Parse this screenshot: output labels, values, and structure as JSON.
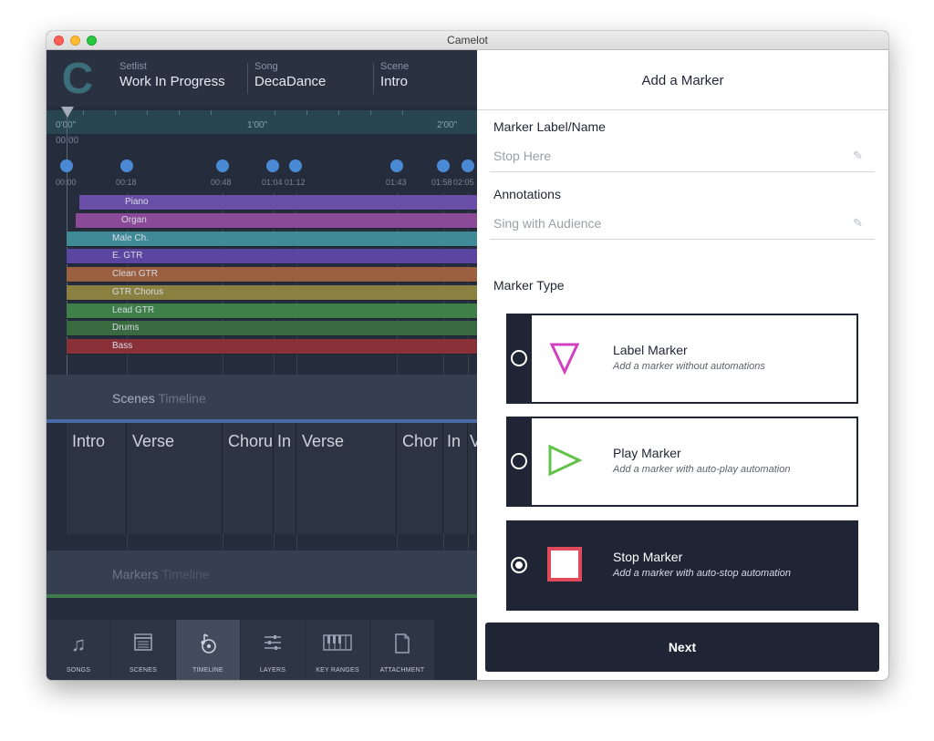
{
  "window": {
    "title": "Camelot"
  },
  "header": {
    "setlist_label": "Setlist",
    "setlist_value": "Work In Progress",
    "song_label": "Song",
    "song_value": "DecaDance",
    "scene_label": "Scene",
    "scene_value": "Intro"
  },
  "timeline": {
    "ruler_labels": [
      "0'00\"",
      "1'00\"",
      "2'00\""
    ],
    "playhead_time": "00:00",
    "marker_times": [
      "00:00",
      "00:18",
      "00:48",
      "01:04",
      "01:12",
      "01:43",
      "01:58",
      "02:05"
    ],
    "tracks": [
      {
        "name": "Piano",
        "color": "#6a4fa8"
      },
      {
        "name": "Organ",
        "color": "#8a4a98"
      },
      {
        "name": "Male Ch.",
        "color": "#3f8a96"
      },
      {
        "name": "E. GTR",
        "color": "#5a45a0"
      },
      {
        "name": "Clean GTR",
        "color": "#9a6040"
      },
      {
        "name": "GTR Chorus",
        "color": "#8a8040"
      },
      {
        "name": "Lead GTR",
        "color": "#3f8048"
      },
      {
        "name": "Drums",
        "color": "#3a6a40"
      },
      {
        "name": "Bass",
        "color": "#8a3038"
      }
    ],
    "scenes_band": {
      "title": "Scenes",
      "subtitle": "Timeline"
    },
    "scenes": [
      "Intro",
      "Verse",
      "Choru",
      "In",
      "Verse",
      "Chor",
      "In",
      "V"
    ],
    "markers_band": {
      "title": "Markers",
      "subtitle": "Timeline"
    }
  },
  "tabs": [
    {
      "label": "SONGS",
      "icon": "music-note-icon"
    },
    {
      "label": "SCENES",
      "icon": "clapperboard-icon"
    },
    {
      "label": "TIMELINE",
      "icon": "timeline-icon",
      "active": true
    },
    {
      "label": "LAYERS",
      "icon": "sliders-icon"
    },
    {
      "label": "KEY RANGES",
      "icon": "piano-keys-icon"
    },
    {
      "label": "ATTACHMENT",
      "icon": "document-icon"
    }
  ],
  "panel": {
    "title": "Add a Marker",
    "label_field": {
      "label": "Marker Label/Name",
      "value": "Stop Here"
    },
    "annotation_field": {
      "label": "Annotations",
      "value": "Sing with Audience"
    },
    "type_label": "Marker Type",
    "marker_types": [
      {
        "title": "Label Marker",
        "desc": "Add a marker without automations",
        "icon": "triangle-down-icon",
        "color": "#d040c0",
        "selected": false
      },
      {
        "title": "Play Marker",
        "desc": "Add a marker with auto-play automation",
        "icon": "play-triangle-icon",
        "color": "#62c24a",
        "selected": false
      },
      {
        "title": "Stop Marker",
        "desc": "Add a marker with auto-stop automation",
        "icon": "stop-square-icon",
        "color": "#e04a5a",
        "selected": true
      }
    ],
    "next_label": "Next"
  }
}
